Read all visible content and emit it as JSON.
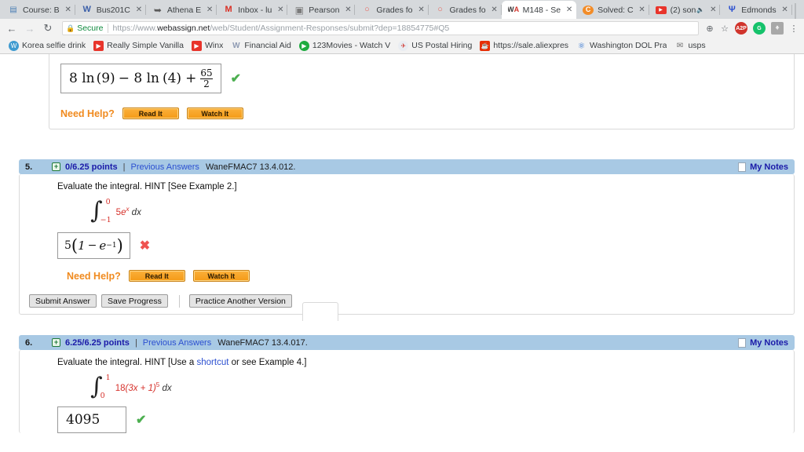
{
  "browser": {
    "tabs": [
      {
        "label": "Course: B",
        "icon": "course-icon",
        "active": false,
        "muted": false
      },
      {
        "label": "Bus201C",
        "icon": "w-icon",
        "active": false,
        "muted": false
      },
      {
        "label": "Athena E",
        "icon": "athena-icon",
        "active": false,
        "muted": false
      },
      {
        "label": "Inbox - lu",
        "icon": "gmail-icon",
        "active": false,
        "muted": false
      },
      {
        "label": "Pearson",
        "icon": "pearson-icon",
        "active": false,
        "muted": false
      },
      {
        "label": "Grades fo",
        "icon": "grades-icon",
        "active": false,
        "muted": false
      },
      {
        "label": "Grades fo",
        "icon": "grades-icon",
        "active": false,
        "muted": false
      },
      {
        "label": "M148 - Se",
        "icon": "webassign-icon",
        "active": true,
        "muted": false
      },
      {
        "label": "Solved: C",
        "icon": "chegg-icon",
        "active": false,
        "muted": false
      },
      {
        "label": "(2) son",
        "icon": "youtube-icon",
        "active": false,
        "muted": true
      },
      {
        "label": "Edmonds",
        "icon": "edmonds-icon",
        "active": false,
        "muted": false
      }
    ],
    "new_tab_label": "",
    "window_controls": {
      "minimize": "–",
      "maximize": "❐",
      "close": "✕"
    },
    "nav": {
      "back": "←",
      "forward": "→",
      "reload": "C"
    },
    "omnibox": {
      "lock": "🔒",
      "secure_label": "Secure",
      "url_scheme": "https://www.",
      "url_host": "webassign.net",
      "url_path": "/web/Student/Assignment-Responses/submit?dep=18854775#Q5"
    },
    "omnibox_icons": [
      {
        "name": "zoom-icon",
        "glyph": "⊕"
      },
      {
        "name": "bookmark-star-icon",
        "glyph": "☆"
      }
    ],
    "extensions": [
      {
        "name": "adblock-icon",
        "label": "A2P",
        "color": "#d0342c"
      },
      {
        "name": "grammarly-icon",
        "label": "G",
        "color": "#15c26b"
      },
      {
        "name": "honey-icon",
        "label": "⚘",
        "color": "#a8a8a8"
      },
      {
        "name": "chrome-menu-icon",
        "label": "⋮",
        "color": "#5f6368"
      }
    ],
    "bookmarks": [
      {
        "label": "Korea selfie drink",
        "icon": "wordpress-icon",
        "color": "#3f9bd0",
        "glyph": "W"
      },
      {
        "label": "Really Simple Vanilla",
        "icon": "youtube-icon",
        "color": "#e8342b",
        "glyph": "▶"
      },
      {
        "label": "Winx",
        "icon": "youtube-icon",
        "color": "#e8342b",
        "glyph": "▶"
      },
      {
        "label": "Financial Aid",
        "icon": "w-icon",
        "color": "#8f9bb3",
        "glyph": "W"
      },
      {
        "label": "123Movies - Watch V",
        "icon": "play-icon",
        "color": "#1dab3f",
        "glyph": "▶"
      },
      {
        "label": "US Postal Hiring",
        "icon": "usps-icon",
        "color": "#d0342c",
        "glyph": "✉"
      },
      {
        "label": "https://sale.aliexpres",
        "icon": "aliexpress-icon",
        "color": "#e62e04",
        "glyph": "◡"
      },
      {
        "label": "Washington DOL Pra",
        "icon": "dol-icon",
        "color": "#2b6fd0",
        "glyph": "⚑"
      },
      {
        "label": "usps",
        "icon": "usps-gray-icon",
        "color": "#6d6d6d",
        "glyph": "✉"
      }
    ]
  },
  "page": {
    "top_block": {
      "answer": "8 ln(9) − 8 ln(4) + 65/2",
      "answer_parts": {
        "lead": "8 ln",
        "a": "(9)",
        "minus": "− 8 ln",
        "b": "(4)",
        "plus": "+",
        "num": "65",
        "den": "2"
      },
      "mark": "✔",
      "need_help_label": "Need Help?",
      "read_it": "Read It",
      "watch_it": "Watch It"
    },
    "questions": [
      {
        "number": "5.",
        "points": "0/6.25 points",
        "plus": "+",
        "separator": "|",
        "previous_answers": "Previous Answers",
        "reference": "WaneFMAC7 13.4.012.",
        "my_notes": "My Notes",
        "prompt": "Evaluate the integral. HINT [See Example 2.]",
        "prompt_link": "",
        "integral": {
          "upper": "0",
          "lower": "−1",
          "coefficient": "5",
          "integrand": "e",
          "exponent": "x",
          "differential": "dx"
        },
        "answer": "5(1 − e⁻¹)",
        "answer_parts": {
          "coef": "5",
          "open": "(",
          "one": "1",
          "minus": "−",
          "e": "e",
          "exp": "−1",
          "close": ")"
        },
        "mark": "✖",
        "mark_state": "incorrect",
        "need_help_label": "Need Help?",
        "read_it": "Read It",
        "watch_it": "Watch It",
        "submit_answer": "Submit Answer",
        "save_progress": "Save Progress",
        "practice_another": "Practice Another Version"
      },
      {
        "number": "6.",
        "points": "6.25/6.25 points",
        "plus": "+",
        "separator": "|",
        "previous_answers": "Previous Answers",
        "reference": "WaneFMAC7 13.4.017.",
        "my_notes": "My Notes",
        "prompt_pre": "Evaluate the integral. HINT [Use a ",
        "prompt_link": "shortcut",
        "prompt_post": " or see Example 4.]",
        "integral": {
          "upper": "1",
          "lower": "0",
          "coefficient": "18",
          "integrand": "(3x + 1)",
          "exponent": "5",
          "differential": "dx"
        },
        "answer": "4095",
        "mark": "✔",
        "mark_state": "correct"
      }
    ]
  },
  "colors": {
    "question_header_bg": "#a8c9e4",
    "points_text": "#1a1aa8",
    "link": "#2b4fd0",
    "need_help": "#f08a1e",
    "help_button": "#f49a16",
    "correct": "#4caf50",
    "incorrect": "#ef5350",
    "math_red": "#d6322c",
    "secure_green": "#0f8a3e"
  }
}
